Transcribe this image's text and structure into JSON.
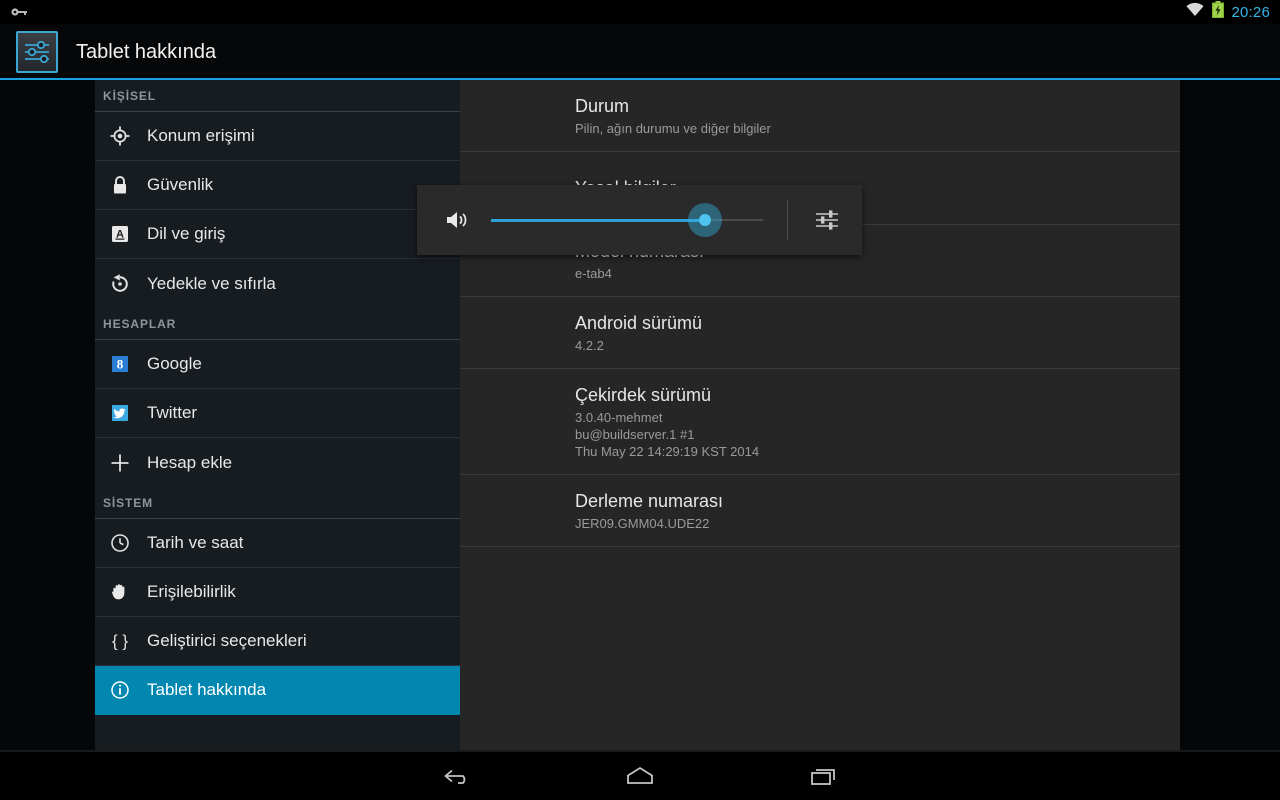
{
  "statusbar": {
    "left_icon": "key-icon",
    "wifi_icon": "wifi-icon",
    "battery_icon": "battery-charging-icon",
    "time": "20:26"
  },
  "actionbar": {
    "app_icon": "settings-sliders-icon",
    "title": "Tablet hakkında",
    "accent_color": "#1ba1e2"
  },
  "volume_panel": {
    "speaker_icon": "speaker-volume-icon",
    "equalizer_icon": "audio-settings-icon",
    "slider": {
      "value_percent": 79,
      "min": 0,
      "max": 100,
      "fill_color": "#2f9fd8",
      "thumb_color": "#4ec3f0"
    }
  },
  "sidebar": {
    "selected_color": "#0288b0",
    "groups": [
      {
        "header": "KİŞİSEL",
        "items": [
          {
            "label": "Konum erişimi",
            "icon": "location-crosshair-icon",
            "selected": false
          },
          {
            "label": "Güvenlik",
            "icon": "lock-icon",
            "selected": false
          },
          {
            "label": "Dil ve giriş",
            "icon": "language-a-icon",
            "selected": false
          },
          {
            "label": "Yedekle ve sıfırla",
            "icon": "backup-restore-icon",
            "selected": false
          }
        ]
      },
      {
        "header": "HESAPLAR",
        "items": [
          {
            "label": "Google",
            "icon": "google-icon",
            "selected": false
          },
          {
            "label": "Twitter",
            "icon": "twitter-icon",
            "selected": false
          },
          {
            "label": "Hesap ekle",
            "icon": "plus-icon",
            "selected": false
          }
        ]
      },
      {
        "header": "SİSTEM",
        "items": [
          {
            "label": "Tarih ve saat",
            "icon": "clock-icon",
            "selected": false
          },
          {
            "label": "Erişilebilirlik",
            "icon": "hand-icon",
            "selected": false
          },
          {
            "label": "Geliştirici seçenekleri",
            "icon": "curly-braces-icon",
            "selected": false
          },
          {
            "label": "Tablet hakkında",
            "icon": "info-circle-icon",
            "selected": true
          }
        ]
      }
    ]
  },
  "main": {
    "preferences": [
      {
        "title": "Durum",
        "summary": "Pilin, ağın durumu ve diğer bilgiler"
      },
      {
        "title": "Yasal bilgiler",
        "summary": ""
      },
      {
        "title": "Model numarası",
        "summary": "e-tab4"
      },
      {
        "title": "Android sürümü",
        "summary": "4.2.2"
      },
      {
        "title": "Çekirdek sürümü",
        "summary": "3.0.40-mehmet\nbu@buildserver.1 #1\nThu May 22 14:29:19 KST 2014"
      },
      {
        "title": "Derleme numarası",
        "summary": "JER09.GMM04.UDE22"
      }
    ]
  },
  "navbar": {
    "back_icon": "back-arrow-icon",
    "home_icon": "home-icon",
    "recents_icon": "recent-apps-icon"
  }
}
